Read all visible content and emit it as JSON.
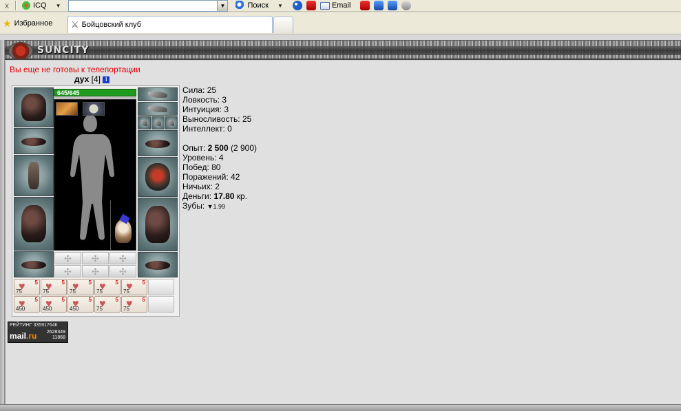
{
  "toolbar": {
    "close": "x",
    "icq_label": "ICQ",
    "search_label": "Поиск",
    "email_label": "Email",
    "address_value": ""
  },
  "tabbar": {
    "favorites_label": "Избранное",
    "active_tab_label": "Бойцовский клуб"
  },
  "header": {
    "logo_text": "SUNCITY"
  },
  "teleport_message": "Вы еще не готовы к телепортации",
  "character": {
    "name": "дух",
    "level": "[4]",
    "info_icon": "i",
    "hp": "645/645"
  },
  "stats": [
    "Сила: 25",
    "Ловкость: 3",
    "Интуиция: 3",
    "Выносливость: 25",
    "Интеллект: 0"
  ],
  "stats2": {
    "exp_label": "Опыт: ",
    "exp_value": "2 500",
    "exp_next": " (2 900)",
    "level_line": "Уровень: 4",
    "wins_line": "Побед: 80",
    "losses_line": "Поражений: 42",
    "draws_line": "Ничьих: 2",
    "money_label": "Деньги: ",
    "money_value": "17.80",
    "money_unit": " кр.",
    "teeth_label": "Зубы: ",
    "teeth_value": "1.99"
  },
  "scrolls": [
    {
      "lvl": "5",
      "num": "75"
    },
    {
      "lvl": "5",
      "num": "75"
    },
    {
      "lvl": "5",
      "num": "75"
    },
    {
      "lvl": "5",
      "num": "75"
    },
    {
      "lvl": "5",
      "num": "75"
    },
    {
      "lvl": "5",
      "num": "450"
    },
    {
      "lvl": "5",
      "num": "450"
    },
    {
      "lvl": "5",
      "num": "450"
    },
    {
      "lvl": "5",
      "num": "75"
    },
    {
      "lvl": "5",
      "num": "75"
    }
  ],
  "mail_badge": {
    "rating": "РЕЙТИНГ 33591764К",
    "logo_main": "mail",
    "logo_suffix": ".ru",
    "n1": "2628349",
    "n2": "11868"
  },
  "icons": [
    "close-icon",
    "icq-icon",
    "search-icon",
    "email-icon",
    "star-icon",
    "swords-icon",
    "info-icon",
    "heart-icon"
  ]
}
